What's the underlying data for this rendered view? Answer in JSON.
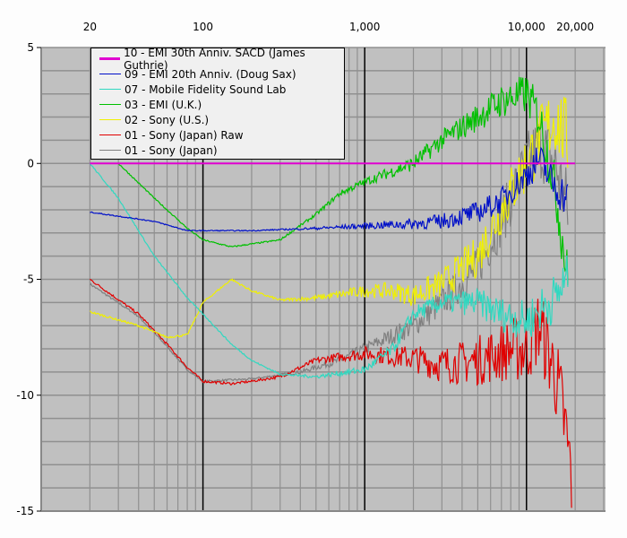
{
  "chart_data": {
    "type": "line",
    "xscale": "log",
    "xlim": [
      10,
      30800
    ],
    "ylim": [
      -15,
      5
    ],
    "x_ticks": [
      {
        "v": 20,
        "label": "20"
      },
      {
        "v": 100,
        "label": "100"
      },
      {
        "v": 1000,
        "label": "1,000"
      },
      {
        "v": 10000,
        "label": "10,000"
      },
      {
        "v": 20000,
        "label": "20,000"
      }
    ],
    "y_ticks": [
      {
        "v": 5,
        "label": "5"
      },
      {
        "v": 0,
        "label": "0"
      },
      {
        "v": -5,
        "label": "-5"
      },
      {
        "v": -10,
        "label": "-10"
      },
      {
        "v": -15,
        "label": "-15"
      }
    ],
    "grid": true,
    "legend_position": "top-left",
    "series": [
      {
        "name": "10 - EMI 30th Anniv. SACD (James Guthrie)",
        "color": "#e000d0",
        "noise": 0,
        "points": [
          [
            20,
            0
          ],
          [
            20000,
            0
          ]
        ]
      },
      {
        "name": "09 - EMI 20th Anniv. (Doug Sax)",
        "color": "#0010c8",
        "noise": 0.15,
        "points": [
          [
            20,
            -2.1
          ],
          [
            50,
            -2.5
          ],
          [
            80,
            -2.9
          ],
          [
            100,
            -2.9
          ],
          [
            200,
            -2.9
          ],
          [
            500,
            -2.8
          ],
          [
            1000,
            -2.7
          ],
          [
            2000,
            -2.6
          ],
          [
            3000,
            -2.5
          ],
          [
            5000,
            -2.1
          ],
          [
            7000,
            -1.6
          ],
          [
            10000,
            -0.5
          ],
          [
            12000,
            0.2
          ],
          [
            15000,
            -1
          ],
          [
            18000,
            -1.5
          ]
        ]
      },
      {
        "name": "07 - Mobile Fidelity Sound Lab",
        "color": "#30d8c0",
        "noise": 0.2,
        "points": [
          [
            20,
            0
          ],
          [
            30,
            -1.5
          ],
          [
            50,
            -4
          ],
          [
            80,
            -5.8
          ],
          [
            100,
            -6.5
          ],
          [
            150,
            -7.8
          ],
          [
            200,
            -8.5
          ],
          [
            300,
            -9.1
          ],
          [
            500,
            -9.2
          ],
          [
            1000,
            -8.9
          ],
          [
            1500,
            -8
          ],
          [
            2000,
            -6.5
          ],
          [
            3000,
            -6
          ],
          [
            5000,
            -6
          ],
          [
            7000,
            -6.5
          ],
          [
            10000,
            -6.8
          ],
          [
            15000,
            -5.8
          ],
          [
            18000,
            -5
          ]
        ]
      },
      {
        "name": "03 - EMI (U.K.)",
        "color": "#00c000",
        "noise": 0.2,
        "points": [
          [
            30,
            0
          ],
          [
            50,
            -1.5
          ],
          [
            80,
            -2.8
          ],
          [
            100,
            -3.3
          ],
          [
            150,
            -3.6
          ],
          [
            300,
            -3.3
          ],
          [
            500,
            -2.2
          ],
          [
            700,
            -1.3
          ],
          [
            1000,
            -0.8
          ],
          [
            2000,
            0
          ],
          [
            3000,
            1
          ],
          [
            5000,
            2
          ],
          [
            7000,
            2.7
          ],
          [
            10000,
            3
          ],
          [
            12000,
            2
          ],
          [
            15000,
            -1
          ],
          [
            18000,
            -5
          ]
        ]
      },
      {
        "name": "02 - Sony (U.S.)",
        "color": "#f0f000",
        "noise": 0.3,
        "points": [
          [
            20,
            -6.4
          ],
          [
            40,
            -7
          ],
          [
            60,
            -7.5
          ],
          [
            80,
            -7.4
          ],
          [
            100,
            -6
          ],
          [
            150,
            -5
          ],
          [
            200,
            -5.5
          ],
          [
            300,
            -5.9
          ],
          [
            500,
            -5.8
          ],
          [
            1000,
            -5.5
          ],
          [
            1500,
            -5.5
          ],
          [
            2000,
            -5.7
          ],
          [
            3000,
            -5.2
          ],
          [
            5000,
            -4
          ],
          [
            7000,
            -2
          ],
          [
            10000,
            0
          ],
          [
            12000,
            1
          ],
          [
            15000,
            2
          ],
          [
            18000,
            1
          ]
        ]
      },
      {
        "name": "01 - Sony (Japan) Raw",
        "color": "#e00000",
        "noise": 0.35,
        "points": [
          [
            20,
            -5
          ],
          [
            40,
            -6.5
          ],
          [
            60,
            -7.8
          ],
          [
            80,
            -8.8
          ],
          [
            100,
            -9.4
          ],
          [
            150,
            -9.5
          ],
          [
            200,
            -9.4
          ],
          [
            300,
            -9.2
          ],
          [
            500,
            -8.5
          ],
          [
            1000,
            -8.2
          ],
          [
            2000,
            -8.4
          ],
          [
            3000,
            -8.7
          ],
          [
            5000,
            -8.5
          ],
          [
            8000,
            -8
          ],
          [
            10000,
            -8
          ],
          [
            12000,
            -7
          ],
          [
            15000,
            -9
          ],
          [
            17000,
            -11
          ],
          [
            19000,
            -13.5
          ]
        ]
      },
      {
        "name": "01 - Sony (Japan)",
        "color": "#808080",
        "noise": 0.3,
        "points": [
          [
            20,
            -5.2
          ],
          [
            40,
            -6.6
          ],
          [
            60,
            -7.9
          ],
          [
            80,
            -8.9
          ],
          [
            100,
            -9.4
          ],
          [
            200,
            -9.3
          ],
          [
            400,
            -9
          ],
          [
            700,
            -8.5
          ],
          [
            1000,
            -8
          ],
          [
            2000,
            -7
          ],
          [
            3000,
            -6
          ],
          [
            5000,
            -4.5
          ],
          [
            7000,
            -2.5
          ],
          [
            10000,
            0
          ],
          [
            12000,
            0.8
          ],
          [
            15000,
            0
          ],
          [
            18000,
            -2
          ]
        ]
      }
    ],
    "draw_order": [
      6,
      5,
      4,
      3,
      2,
      1,
      0
    ]
  }
}
